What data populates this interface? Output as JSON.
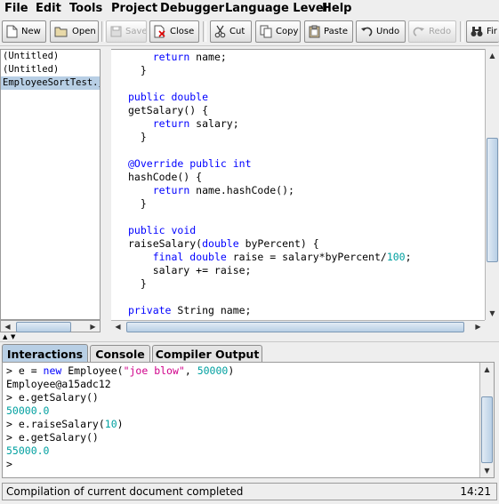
{
  "menu": [
    "File",
    "Edit",
    "Tools",
    "Project",
    "Debugger",
    "Language Level",
    "Help"
  ],
  "toolbar": {
    "new": "New",
    "open": "Open",
    "save": "Save",
    "close": "Close",
    "cut": "Cut",
    "copy": "Copy",
    "paste": "Paste",
    "undo": "Undo",
    "redo": "Redo",
    "find": "Fir"
  },
  "documents": [
    "(Untitled)",
    "(Untitled)",
    "EmployeeSortTest.ja"
  ],
  "editor_lines": [
    [
      [
        "    ",
        ""
      ],
      [
        "return",
        "kw"
      ],
      [
        " name;",
        ""
      ]
    ],
    [
      [
        "  }",
        ""
      ]
    ],
    [
      [
        "",
        ""
      ]
    ],
    [
      [
        "public",
        "kw"
      ],
      [
        " ",
        ""
      ],
      [
        "double",
        "kw"
      ]
    ],
    [
      [
        "getSalary() {",
        ""
      ]
    ],
    [
      [
        "    ",
        ""
      ],
      [
        "return",
        "kw"
      ],
      [
        " salary;",
        ""
      ]
    ],
    [
      [
        "  }",
        ""
      ]
    ],
    [
      [
        "",
        ""
      ]
    ],
    [
      [
        "@Override",
        "ann"
      ],
      [
        " ",
        ""
      ],
      [
        "public",
        "kw"
      ],
      [
        " ",
        ""
      ],
      [
        "int",
        "kw"
      ]
    ],
    [
      [
        "hashCode() {",
        ""
      ]
    ],
    [
      [
        "    ",
        ""
      ],
      [
        "return",
        "kw"
      ],
      [
        " name.hashCode();",
        ""
      ]
    ],
    [
      [
        "  }",
        ""
      ]
    ],
    [
      [
        "",
        ""
      ]
    ],
    [
      [
        "public",
        "kw"
      ],
      [
        " ",
        ""
      ],
      [
        "void",
        "kw"
      ]
    ],
    [
      [
        "raiseSalary(",
        ""
      ],
      [
        "double",
        "kw"
      ],
      [
        " byPercent) {",
        ""
      ]
    ],
    [
      [
        "    ",
        ""
      ],
      [
        "final",
        "kw"
      ],
      [
        " ",
        ""
      ],
      [
        "double",
        "kw"
      ],
      [
        " raise = salary*byPercent/",
        ""
      ],
      [
        "100",
        "num"
      ],
      [
        ";",
        ""
      ]
    ],
    [
      [
        "    salary += raise;",
        ""
      ]
    ],
    [
      [
        "  }",
        ""
      ]
    ],
    [
      [
        "",
        ""
      ]
    ],
    [
      [
        "private",
        "kw"
      ],
      [
        " String name;",
        ""
      ]
    ]
  ],
  "tabs": [
    "Interactions",
    "Console",
    "Compiler Output"
  ],
  "interactions": [
    [
      [
        "> e = ",
        ""
      ],
      [
        "new",
        "kw"
      ],
      [
        " Employee(",
        ""
      ],
      [
        "\"joe blow\"",
        "str"
      ],
      [
        ", ",
        ""
      ],
      [
        "50000",
        "num"
      ],
      [
        ")",
        ""
      ]
    ],
    [
      [
        "Employee@a15adc12",
        ""
      ]
    ],
    [
      [
        "> e.getSalary()",
        ""
      ]
    ],
    [
      [
        "50000.0",
        "num"
      ]
    ],
    [
      [
        "> e.raiseSalary(",
        ""
      ],
      [
        "10",
        "num"
      ],
      [
        ")",
        ""
      ]
    ],
    [
      [
        "> e.getSalary()",
        ""
      ]
    ],
    [
      [
        "55000.0",
        "num"
      ]
    ],
    [
      [
        ">",
        ""
      ]
    ]
  ],
  "status": {
    "message": "Compilation of current document completed",
    "time": "14:21"
  }
}
